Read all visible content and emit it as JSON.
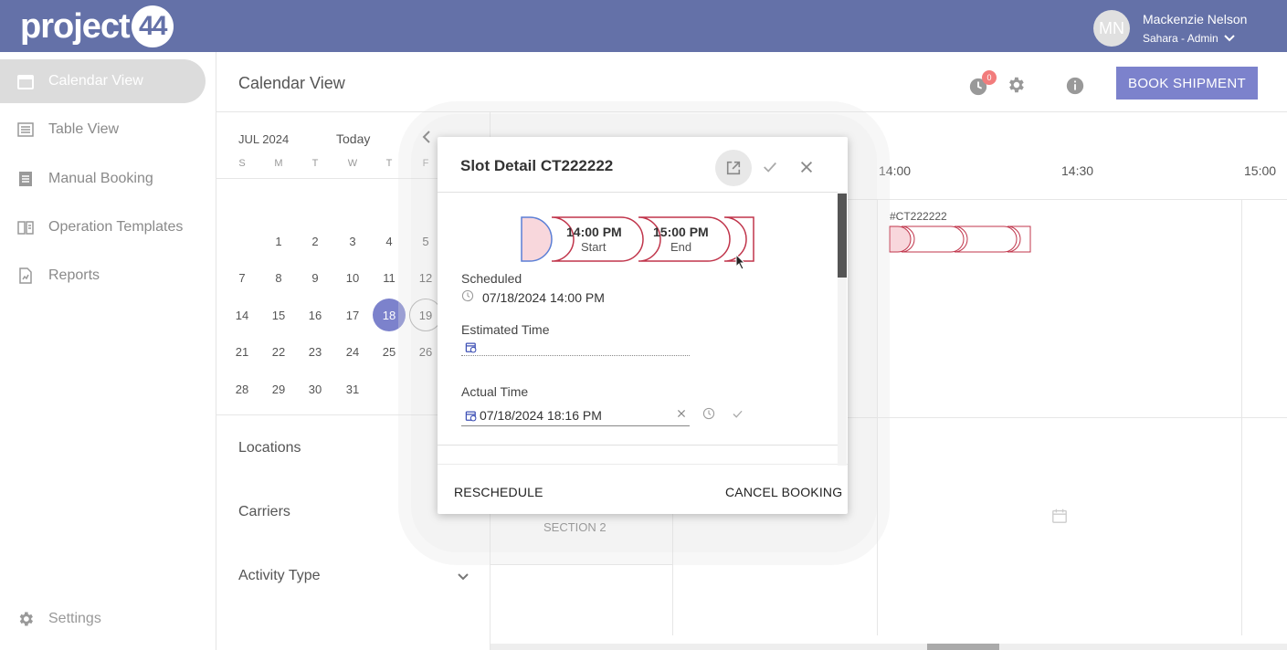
{
  "brand": {
    "logo_text": "project",
    "logo_num": "44"
  },
  "user": {
    "initials": "MN",
    "name": "Mackenzie Nelson",
    "org": "Sahara - Admin"
  },
  "sidebar": {
    "items": [
      {
        "label": "Calendar View",
        "icon": "calendar-icon",
        "active": true
      },
      {
        "label": "Table View",
        "icon": "list-icon"
      },
      {
        "label": "Manual Booking",
        "icon": "booking-icon"
      },
      {
        "label": "Operation Templates",
        "icon": "template-icon"
      },
      {
        "label": "Reports",
        "icon": "report-icon"
      }
    ],
    "settings_label": "Settings"
  },
  "header": {
    "title": "Calendar View",
    "notification_count": "0",
    "book_button": "BOOK SHIPMENT"
  },
  "calendar": {
    "month": "JUL 2024",
    "today": "Today",
    "weekdays": [
      "S",
      "M",
      "T",
      "W",
      "T",
      "F"
    ],
    "selected_day": "18",
    "today_day": "19",
    "days": [
      [
        "",
        "1",
        "2",
        "3",
        "4",
        "5"
      ],
      [
        "7",
        "8",
        "9",
        "10",
        "11",
        "12"
      ],
      [
        "14",
        "15",
        "16",
        "17",
        "18",
        "19"
      ],
      [
        "21",
        "22",
        "23",
        "24",
        "25",
        "26"
      ],
      [
        "28",
        "29",
        "30",
        "31",
        "",
        ""
      ]
    ]
  },
  "filters": {
    "locations": "Locations",
    "carriers": "Carriers",
    "activity_type": "Activity Type"
  },
  "timeline": {
    "times": [
      "14:00",
      "14:30",
      "15:00"
    ],
    "slot_tag": "#CT222222",
    "section": "SECTION 2"
  },
  "modal": {
    "title": "Slot Detail CT222222",
    "start_time": "14:00 PM",
    "start_label": "Start",
    "end_time": "15:00 PM",
    "end_label": "End",
    "scheduled_label": "Scheduled",
    "scheduled_value": "07/18/2024 14:00 PM",
    "estimated_label": "Estimated Time",
    "estimated_value": "",
    "actual_label": "Actual Time",
    "actual_value": "07/18/2024 18:16 PM",
    "reschedule": "RESCHEDULE",
    "cancel": "CANCEL BOOKING"
  },
  "colors": {
    "topbar": "#6471a8",
    "accent": "#7c82cc",
    "slot_border": "#c0354b",
    "slot_fill": "#f8d7dc",
    "start_blue": "#5b7fd6"
  }
}
